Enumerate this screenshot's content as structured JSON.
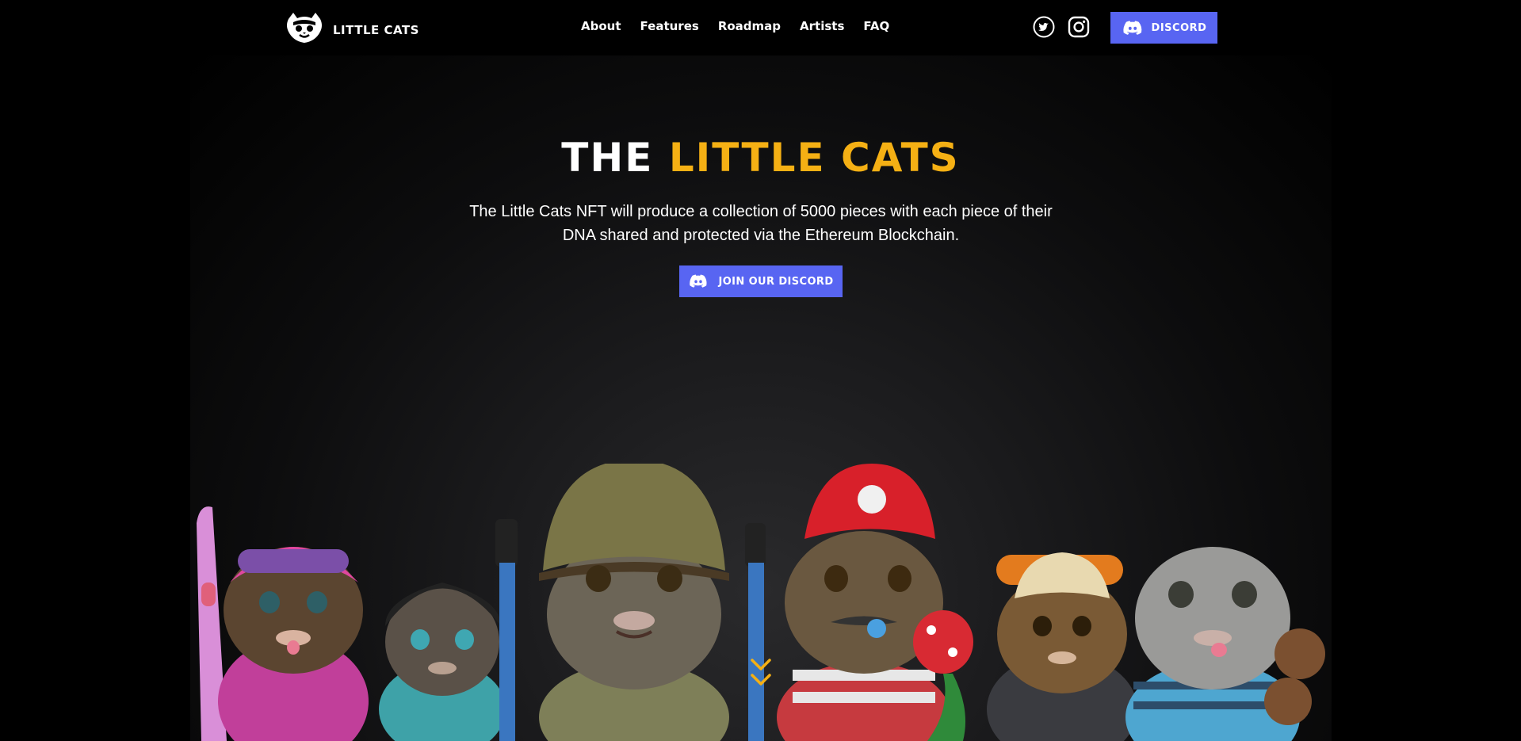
{
  "header": {
    "logo_text": "LITTLE CATS",
    "nav": [
      "About",
      "Features",
      "Roadmap",
      "Artists",
      "FAQ"
    ],
    "discord_label": "DISCORD"
  },
  "hero": {
    "title_part1": "THE ",
    "title_part2": "LITTLE CATS",
    "description": "The Little Cats NFT will produce a collection of 5000 pieces with each piece of their DNA shared and protected via the Ethereum Blockchain.",
    "cta_label": "JOIN OUR DISCORD"
  },
  "colors": {
    "accent": "#f5b014",
    "discord": "#5865f2",
    "background": "#000000"
  },
  "icons": [
    "cat-logo-icon",
    "twitter-icon",
    "instagram-icon",
    "discord-icon",
    "scroll-down-icon"
  ]
}
